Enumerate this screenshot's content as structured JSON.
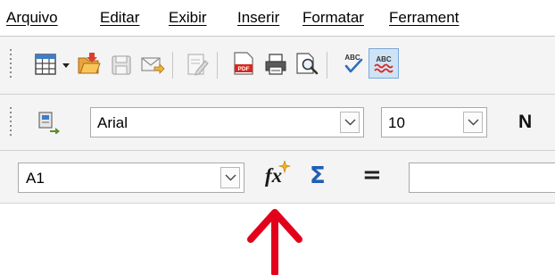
{
  "menu": {
    "items": [
      {
        "label": "Arquivo",
        "mnemonic": "A"
      },
      {
        "label": "Editar",
        "mnemonic": "E"
      },
      {
        "label": "Exibir",
        "mnemonic": "x"
      },
      {
        "label": "Inserir",
        "mnemonic": "I"
      },
      {
        "label": "Formatar",
        "mnemonic": "F"
      },
      {
        "label": "Ferrament",
        "mnemonic": "r"
      }
    ]
  },
  "standard_toolbar": {
    "icons": [
      "table-icon",
      "dropdown-arrow-icon",
      "open-folder-icon",
      "save-icon",
      "email-icon",
      "edit-document-icon",
      "export-pdf-icon",
      "print-icon",
      "print-preview-icon",
      "spellcheck-icon",
      "autospellcheck-icon"
    ]
  },
  "formatting_toolbar": {
    "font_name": "Arial",
    "font_size": "10",
    "bold_label": "N"
  },
  "formula_bar": {
    "cell_reference": "A1",
    "function_wizard_label": "fx",
    "sum_label": "Σ",
    "formula_label": "=",
    "input_value": ""
  },
  "annotation": {
    "arrow_color": "#e3001b"
  }
}
